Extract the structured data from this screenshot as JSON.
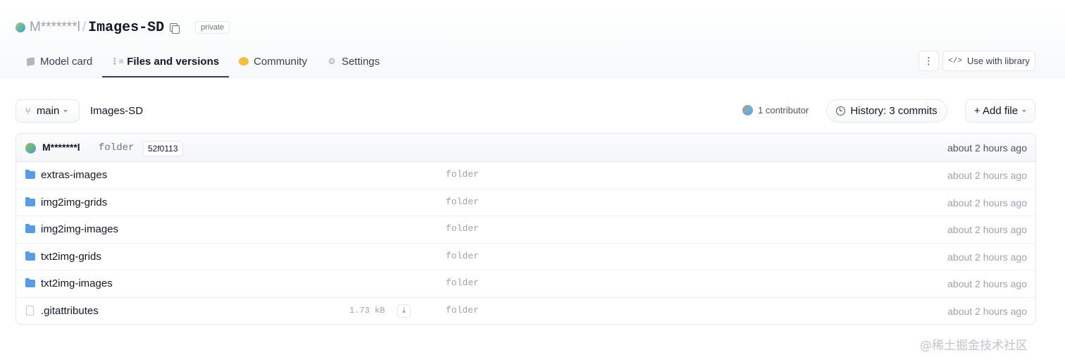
{
  "repo": {
    "owner": "M*******l",
    "separator": "/",
    "name": "Images-SD",
    "visibility": "private"
  },
  "tabs": [
    {
      "label": "Model card",
      "icon": "cube-icon"
    },
    {
      "label": "Files and versions",
      "icon": "files-icon",
      "active": true
    },
    {
      "label": "Community",
      "icon": "hugging-face-icon"
    },
    {
      "label": "Settings",
      "icon": "gear-icon"
    }
  ],
  "actions": {
    "menu_icon": "⋮",
    "use_with_library": "Use with library",
    "code_symbol": "</>"
  },
  "toolbar": {
    "branch": "main",
    "breadcrumb": "Images-SD",
    "contributors": "1 contributor",
    "history": "History: 3 commits",
    "add_file": "+ Add file"
  },
  "last_commit": {
    "author": "M*******l",
    "message": "folder",
    "hash": "52f0113",
    "time": "about 2 hours ago"
  },
  "files": [
    {
      "name": "extras-images",
      "type": "folder",
      "message": "folder",
      "time": "about 2 hours ago"
    },
    {
      "name": "img2img-grids",
      "type": "folder",
      "message": "folder",
      "time": "about 2 hours ago"
    },
    {
      "name": "img2img-images",
      "type": "folder",
      "message": "folder",
      "time": "about 2 hours ago"
    },
    {
      "name": "txt2img-grids",
      "type": "folder",
      "message": "folder",
      "time": "about 2 hours ago"
    },
    {
      "name": "txt2img-images",
      "type": "folder",
      "message": "folder",
      "time": "about 2 hours ago"
    },
    {
      "name": ".gitattributes",
      "type": "file",
      "size": "1.73 kB",
      "message": "folder",
      "time": "about 2 hours ago"
    }
  ],
  "watermark": "@稀土掘金技术社区",
  "colors": {
    "folder": "#5a9be6",
    "accent": "#111827",
    "muted": "#9ca3af"
  }
}
